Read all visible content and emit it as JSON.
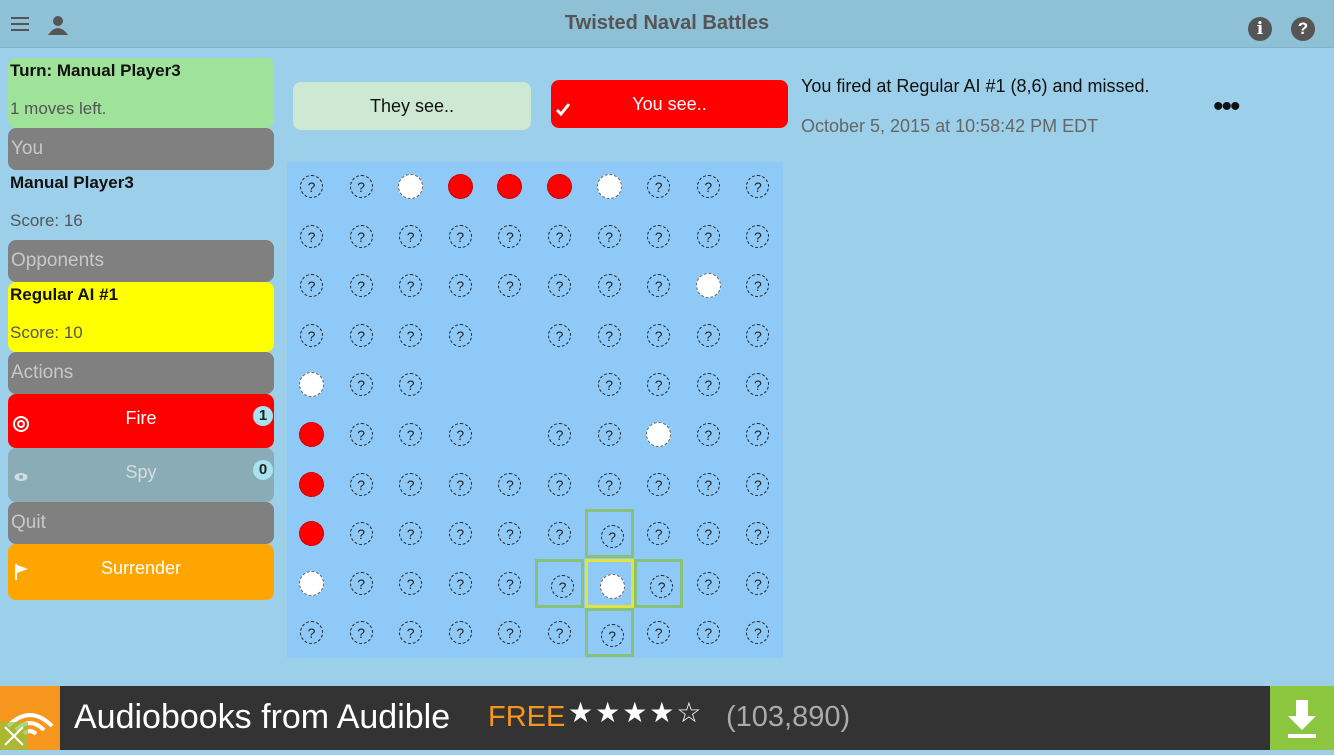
{
  "app": {
    "title": "Twisted Naval Battles"
  },
  "turn": {
    "label": "Turn: Manual Player3",
    "moves_left": "1 moves left."
  },
  "you": {
    "header": "You",
    "name": "Manual Player3",
    "score": "Score: 16"
  },
  "opponents": {
    "header": "Opponents",
    "name": "Regular AI #1",
    "score": "Score: 10"
  },
  "actions": {
    "header": "Actions",
    "fire": {
      "label": "Fire",
      "count": "1",
      "icon": "target-icon"
    },
    "spy": {
      "label": "Spy",
      "count": "0",
      "icon": "eye-icon"
    }
  },
  "quit": {
    "header": "Quit",
    "surrender_label": "Surrender",
    "icon": "flag-icon"
  },
  "view_toggle": {
    "they_see": "They see..",
    "you_see": "You see..",
    "selected": "you_see"
  },
  "message": {
    "text": "You fired at Regular AI #1 (8,6) and missed.",
    "timestamp": "October 5, 2015 at 10:58:42 PM EDT"
  },
  "more_label": "•••",
  "board": {
    "unknown_glyph": "?",
    "rows": [
      [
        "?",
        "?",
        "O",
        "X",
        "X",
        "X",
        "O",
        "?",
        "?",
        "?"
      ],
      [
        "?",
        "?",
        "?",
        "?",
        "?",
        "?",
        "?",
        "?",
        "?",
        "?"
      ],
      [
        "?",
        "?",
        "?",
        "?",
        "?",
        "?",
        "?",
        "?",
        "O",
        "?"
      ],
      [
        "?",
        "?",
        "?",
        "?",
        "",
        "?",
        "?",
        "?",
        "?",
        "?"
      ],
      [
        "O",
        "?",
        "?",
        "",
        "",
        "",
        "?",
        "?",
        "?",
        "?"
      ],
      [
        "X",
        "?",
        "?",
        "?",
        "",
        "?",
        "?",
        "O",
        "?",
        "?"
      ],
      [
        "X",
        "?",
        "?",
        "?",
        "?",
        "?",
        "?",
        "?",
        "?",
        "?"
      ],
      [
        "X",
        "?",
        "?",
        "?",
        "?",
        "?",
        "?",
        "?",
        "?",
        "?"
      ],
      [
        "O",
        "?",
        "?",
        "?",
        "?",
        "?",
        "O",
        "?",
        "?",
        "?"
      ],
      [
        "?",
        "?",
        "?",
        "?",
        "?",
        "?",
        "?",
        "?",
        "?",
        "?"
      ]
    ],
    "selected_cell": [
      8,
      6
    ],
    "highlight_cells": [
      [
        7,
        6
      ],
      [
        8,
        5
      ],
      [
        8,
        7
      ],
      [
        9,
        6
      ]
    ]
  },
  "colors": {
    "hit": "#ff0000",
    "miss": "#ffffff",
    "accent_fire": "#ff0000",
    "accent_surrender": "#ffa500",
    "opponent": "#ffff00",
    "turn": "#9fe39a"
  },
  "ad": {
    "text": "Audiobooks from Audible",
    "free_label": "FREE",
    "stars": "★★★★☆",
    "count": "(103,890)"
  }
}
